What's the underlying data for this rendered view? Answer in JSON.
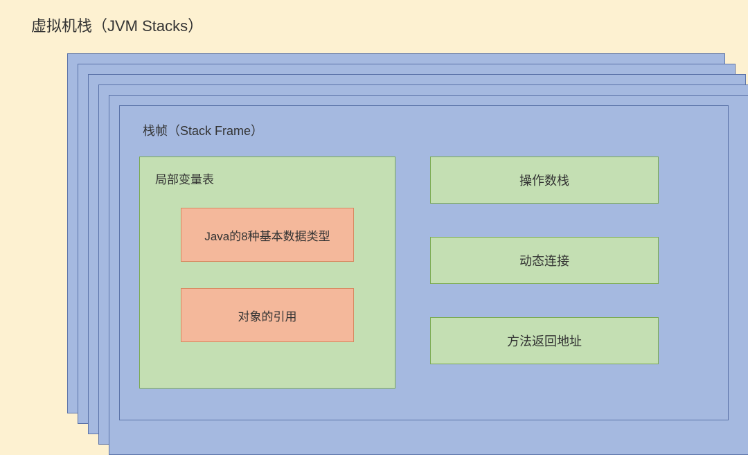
{
  "title": "虚拟机栈（JVM Stacks）",
  "stackFrame": {
    "title": "栈帧（Stack Frame）",
    "localVarTable": {
      "title": "局部变量表",
      "items": {
        "primitives": "Java的8种基本数据类型",
        "references": "对象的引用"
      }
    },
    "rightItems": {
      "operandStack": "操作数栈",
      "dynamicLinking": "动态连接",
      "returnAddress": "方法返回地址"
    }
  }
}
